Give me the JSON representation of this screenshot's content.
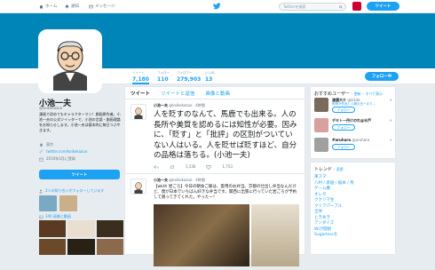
{
  "nav": {
    "home": "ホーム",
    "notifications": "通知",
    "messages": "メッセージ",
    "search_placeholder": "Twitterを検索",
    "tweet_button": "ツイート"
  },
  "stats": [
    {
      "label": "ツイート",
      "value": "7,180"
    },
    {
      "label": "フォロー",
      "value": "110"
    },
    {
      "label": "フォロワー",
      "value": "279,903"
    },
    {
      "label": "いいね",
      "value": "13"
    }
  ],
  "follow_button": "フォロー中",
  "profile": {
    "name": "小池一夫",
    "handle": "@koikekazuo",
    "bio": "漫画で初めてもキャラクターマン！劇画原作者。小池一夫の公式ツイッターで、小池の言語・劇画理論をお知らせします。小池一夫は基本的に毎日つぶやきます。",
    "location": "東京",
    "url": "twitter.com/koikekazuo",
    "joined": "2010年3月に登録",
    "tweet_to_button": "ツイート"
  },
  "sidebar": {
    "followers_you_know": "2人の知り合いがフォローしています",
    "photos_videos": "340 画像と動画"
  },
  "tabs": [
    "ツイート",
    "ツイートと返信",
    "画像と動画"
  ],
  "tweets": [
    {
      "name": "小池一夫",
      "handle": "@koikekazuo",
      "time": "4時間",
      "text": "人を貶すのなんて、馬鹿でも出来る。人の長所や美質を認めるには知性が必要。因みに、「貶す」と「批評」の区別がついていない人はいる。人を貶せば貶すほど、自分の品格は落ちる。(小池一夫)",
      "retweets": "1,536",
      "likes": "1,753"
    },
    {
      "name": "小池一夫",
      "handle": "@koikekazuo",
      "time": "4時間",
      "text": "【wkth 岩ごろ】今日の朝食ご飯は、愛用のお弁当。京都の仕出し弁当なんだけど、僕が日本でいちばん好きな弁当です。関西に出張に行っていた岩ごろが予約して買ってきてくれた。やったー！"
    }
  ],
  "who_to_follow": {
    "title": "おすすめユーザー",
    "refresh": "更新",
    "view_all": "すべて表示",
    "follow_label": "フォロー",
    "users": [
      {
        "name": "渡邉大介",
        "handle": "@b1da",
        "sub": "飛鳥が作品と人間の白ーまで…",
        "color": "#7a6a5a"
      },
      {
        "name": "デキトー丹けのれ@水戸",
        "handle": "",
        "sub": "",
        "color": "#d9a0a0"
      },
      {
        "name": "#aruhara",
        "handle": "@aruhara",
        "sub": "",
        "color": "#a0a0a0"
      }
    ]
  },
  "trends": {
    "title": "トレンド",
    "change": "変更",
    "items": [
      "東スマ",
      "八村 / 渡邉 / 稲本 / 馬",
      "ゲーム機",
      "オレタ",
      "ククリマ生",
      "クリアパープル",
      "全体",
      "ときめき",
      "アンダイズ",
      "Wiが開始",
      "Sugarlessを"
    ]
  }
}
